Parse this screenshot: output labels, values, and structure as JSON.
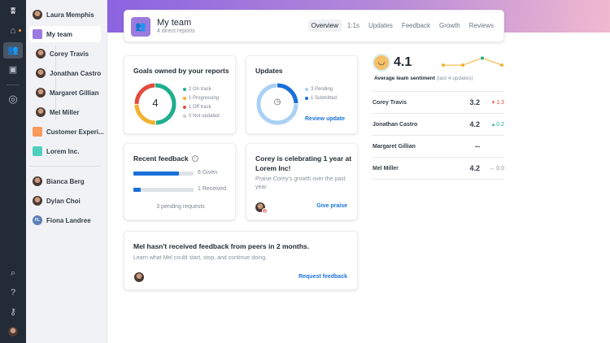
{
  "sidebar": {
    "user": "Laura Memphis",
    "my_team": "My team",
    "reports": [
      "Corey Travis",
      "Jonathan Castro",
      "Margaret Gillian",
      "Mel Miller"
    ],
    "groups": [
      {
        "label": "Customer Experi...",
        "color": "#f79a5c"
      },
      {
        "label": "Lorem Inc.",
        "color": "#4fcfbf"
      }
    ],
    "people": [
      "Bianca Berg",
      "Dylan Choi",
      "Fiona Landree"
    ],
    "fiona_initials": "FL"
  },
  "header": {
    "title": "My team",
    "subtitle": "4 direct reports",
    "tabs": [
      "Overview",
      "1:1s",
      "Updates",
      "Feedback",
      "Growth",
      "Reviews"
    ],
    "active_tab": "Overview"
  },
  "goals": {
    "title": "Goals owned by your reports",
    "total": "4",
    "legend": [
      "2 On track",
      "1 Progressing",
      "1 Off track",
      "0 Not updated"
    ],
    "values": [
      2,
      1,
      1,
      0
    ],
    "colors": [
      "#1fae8d",
      "#f3b02f",
      "#e44b3c",
      "#c5cad1"
    ]
  },
  "updates": {
    "title": "Updates",
    "legend": [
      "3 Pending",
      "1 Submitted"
    ],
    "values": [
      3,
      1
    ],
    "colors": [
      "#a9d0f5",
      "#1a6fd9"
    ],
    "link": "Review update"
  },
  "feedback": {
    "title": "Recent feedback",
    "given": "6 Given",
    "received": "1 Received",
    "given_fraction": 0.75,
    "received_fraction": 0.12,
    "pending": "3 pending requests"
  },
  "anniversary": {
    "title": "Corey is celebrating 1 year at Lorem Inc!",
    "body": "Praise Corey's growth over the past year.",
    "badge": "1",
    "link": "Give praise"
  },
  "mel": {
    "title": "Mel hasn't received feedback from peers in 2 months.",
    "body": "Learn what Mel could start, stop, and continue doing.",
    "link": "Request feedback"
  },
  "sentiment": {
    "score": "4.1",
    "label": "Average team sentiment",
    "sublabel": "(last 4 updates)",
    "trend": [
      4.0,
      4.0,
      4.3,
      4.0
    ],
    "rows": [
      {
        "name": "Corey Travis",
        "score": "3.2",
        "delta": "▾ 1.3",
        "color": "#e44b3c"
      },
      {
        "name": "Jonathan Castro",
        "score": "4.2",
        "delta": "▴ 0.2",
        "color": "#1fae8d"
      },
      {
        "name": "Margaret Gillian",
        "score": "--",
        "delta": "",
        "color": "#888"
      },
      {
        "name": "Mel Miller",
        "score": "4.2",
        "delta": "↔ 0.0",
        "color": "#8a929c"
      }
    ]
  }
}
